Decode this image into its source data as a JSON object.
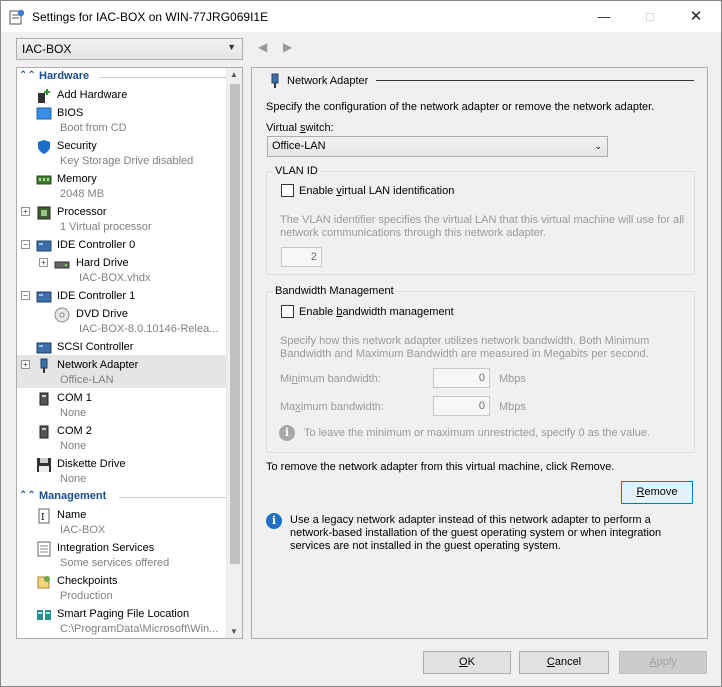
{
  "window": {
    "title": "Settings for IAC-BOX on WIN-77JRG069I1E"
  },
  "vm_selector": {
    "value": "IAC-BOX"
  },
  "tree": {
    "hardware_label": "Hardware",
    "management_label": "Management",
    "hardware_items": [
      {
        "name": "Add Hardware",
        "sub": ""
      },
      {
        "name": "BIOS",
        "sub": "Boot from CD"
      },
      {
        "name": "Security",
        "sub": "Key Storage Drive disabled"
      },
      {
        "name": "Memory",
        "sub": "2048 MB"
      },
      {
        "name": "Processor",
        "sub": "1 Virtual processor"
      },
      {
        "name": "IDE Controller 0",
        "sub": ""
      },
      {
        "name": "Hard Drive",
        "sub": "IAC-BOX.vhdx"
      },
      {
        "name": "IDE Controller 1",
        "sub": ""
      },
      {
        "name": "DVD Drive",
        "sub": "IAC-BOX-8.0.10146-Relea..."
      },
      {
        "name": "SCSI Controller",
        "sub": ""
      },
      {
        "name": "Network Adapter",
        "sub": "Office-LAN"
      },
      {
        "name": "COM 1",
        "sub": "None"
      },
      {
        "name": "COM 2",
        "sub": "None"
      },
      {
        "name": "Diskette Drive",
        "sub": "None"
      }
    ],
    "management_items": [
      {
        "name": "Name",
        "sub": "IAC-BOX"
      },
      {
        "name": "Integration Services",
        "sub": "Some services offered"
      },
      {
        "name": "Checkpoints",
        "sub": "Production"
      },
      {
        "name": "Smart Paging File Location",
        "sub": "C:\\ProgramData\\Microsoft\\Win..."
      }
    ]
  },
  "pane": {
    "title": "Network Adapter",
    "description": "Specify the configuration of the network adapter or remove the network adapter.",
    "virtual_switch_label_pre": "Virtual ",
    "virtual_switch_label_key": "s",
    "virtual_switch_label_post": "witch:",
    "virtual_switch_value": "Office-LAN",
    "vlan": {
      "title": "VLAN ID",
      "checkbox_pre": "Enable ",
      "checkbox_key": "v",
      "checkbox_post": "irtual LAN identification",
      "desc1": "The VLAN identifier specifies the virtual LAN that this virtual machine will use for all",
      "desc2": "network communications through this network adapter.",
      "value": "2"
    },
    "bandwidth": {
      "title": "Bandwidth Management",
      "checkbox_pre": "Enable ",
      "checkbox_key": "b",
      "checkbox_post": "andwidth management",
      "desc1": "Specify how this network adapter utilizes network bandwidth. Both Minimum",
      "desc2": "Bandwidth and Maximum Bandwidth are measured in Megabits per second.",
      "min_pre": "Mi",
      "min_key": "n",
      "min_post": "imum bandwidth:",
      "min_value": "0",
      "max_pre": "Ma",
      "max_key": "x",
      "max_post": "imum bandwidth:",
      "max_value": "0",
      "unit": "Mbps",
      "hint": "To leave the minimum or maximum unrestricted, specify 0 as the value."
    },
    "remove_text": "To remove the network adapter from this virtual machine, click Remove.",
    "remove_button_pre": "",
    "remove_button_key": "R",
    "remove_button_post": "emove",
    "legacy_info1": "Use a legacy network adapter instead of this network adapter to perform a",
    "legacy_info2": "network-based installation of the guest operating system or when integration",
    "legacy_info3": "services are not installed in the guest operating system."
  },
  "buttons": {
    "ok_key": "O",
    "ok_post": "K",
    "cancel_pre": "",
    "cancel_key": "C",
    "cancel_post": "ancel",
    "apply_pre": "",
    "apply_key": "A",
    "apply_post": "pply"
  }
}
